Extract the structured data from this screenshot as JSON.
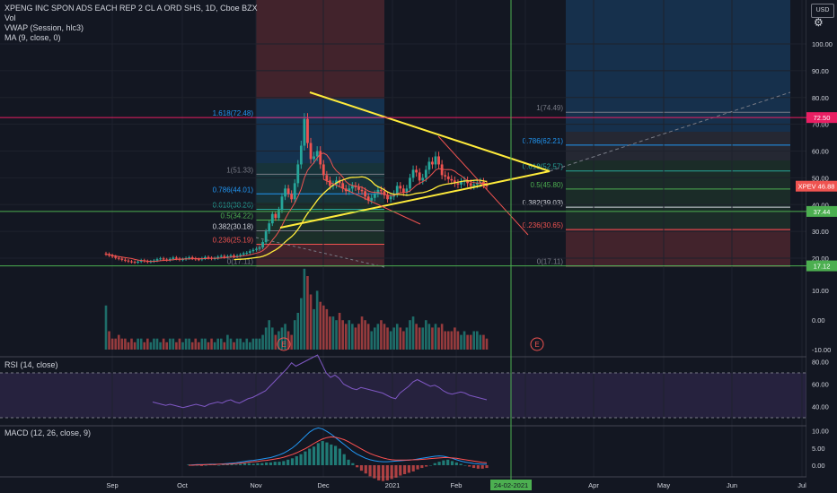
{
  "legend": {
    "symbol": "XPENG INC SPON ADS EACH REP 2 CL A ORD SHS, 1D, Cboe BZX",
    "vol": "Vol",
    "vwap": "VWAP (Session, hlc3)",
    "ma": "MA (9, close, 0)"
  },
  "toolbar": {
    "currency": "USD",
    "settings_icon": "gear-icon"
  },
  "panes": {
    "rsi_label": "RSI (14, close)",
    "macd_label": "MACD (12, 26, close, 9)"
  },
  "colors": {
    "background": "#131722",
    "up": "#26a69a",
    "down": "#ef5350",
    "triangle": "#ffeb3b",
    "green_line": "#4caf50",
    "magenta_line": "#e91e63",
    "rsi_line": "#7e57c2",
    "macd_line": "#2196f3",
    "signal_line": "#ff5252",
    "ma_line": "#ef5350",
    "vwap_line": "#ffeb3b"
  },
  "chart_data": [
    {
      "type": "candlestick",
      "pane": "price",
      "ylim": [
        10,
        105
      ],
      "y_ticks": [
        "100.00",
        "90.00",
        "80.00",
        "70.00",
        "60.00",
        "50.00",
        "40.00",
        "30.00",
        "20.00"
      ],
      "x_ticks": [
        "Sep",
        "Oct",
        "Nov",
        "Dec",
        "2021",
        "Feb",
        "Mar",
        "Apr",
        "May",
        "Jun",
        "Jul"
      ],
      "price_labels": [
        {
          "text": "72.50",
          "value": 72.5,
          "color": "#e91e63"
        },
        {
          "text": "XPEV  46.88",
          "value": 46.88,
          "color": "#ef5350"
        },
        {
          "text": "37.44",
          "value": 37.44,
          "color": "#4caf50"
        },
        {
          "text": "17.12",
          "value": 17.12,
          "color": "#4caf50"
        }
      ],
      "date_label": "24-02-2021",
      "fib_left": [
        {
          "text": "1.618(72.48)",
          "value": 72.48,
          "color": "#2196f3"
        },
        {
          "text": "1(51.33)",
          "value": 51.33,
          "color": "#787b86"
        },
        {
          "text": "0.786(44.01)",
          "value": 44.01,
          "color": "#2196f3"
        },
        {
          "text": "0.618(38.26)",
          "value": 38.26,
          "color": "#26a69a"
        },
        {
          "text": "0.5(34.22)",
          "value": 34.22,
          "color": "#4caf50"
        },
        {
          "text": "0.382(30.18)",
          "value": 30.18,
          "color": "#d1d4dc"
        },
        {
          "text": "0.236(25.19)",
          "value": 25.19,
          "color": "#ef5350"
        },
        {
          "text": "0(17.11)",
          "value": 17.11,
          "color": "#787b86"
        }
      ],
      "fib_right": [
        {
          "text": "1(74.49)",
          "value": 74.49,
          "color": "#787b86"
        },
        {
          "text": "0.786(62.21)",
          "value": 62.21,
          "color": "#2196f3"
        },
        {
          "text": "0.618(52.57)",
          "value": 52.57,
          "color": "#26a69a"
        },
        {
          "text": "0.5(45.80)",
          "value": 45.8,
          "color": "#4caf50"
        },
        {
          "text": "0.382(39.03)",
          "value": 39.03,
          "color": "#d1d4dc"
        },
        {
          "text": "0.236(30.65)",
          "value": 30.65,
          "color": "#ef5350"
        },
        {
          "text": "0(17.11)",
          "value": 17.11,
          "color": "#787b86"
        }
      ],
      "closes": [
        21.5,
        21.0,
        20.6,
        20.1,
        19.8,
        19.4,
        19.1,
        18.8,
        18.6,
        18.4,
        18.7,
        19.2,
        18.9,
        18.6,
        18.8,
        19.1,
        19.6,
        19.9,
        19.5,
        19.3,
        19.7,
        20.2,
        19.8,
        19.4,
        19.6,
        20.0,
        20.3,
        19.9,
        19.6,
        19.5,
        19.9,
        20.4,
        20.1,
        19.8,
        20.0,
        20.5,
        20.8,
        20.4,
        20.7,
        21.0,
        20.6,
        20.9,
        21.3,
        21.8,
        22.0,
        22.6,
        23.1,
        23.5,
        24.0,
        26.0,
        30.0,
        33.0,
        36.5,
        35.0,
        38.0,
        43.0,
        46.0,
        44.0,
        42.0,
        48.0,
        55.0,
        62.0,
        72.0,
        63.0,
        57.0,
        58.0,
        60.0,
        55.0,
        51.0,
        49.0,
        47.0,
        47.5,
        49.0,
        48.0,
        46.0,
        45.0,
        46.0,
        47.0,
        46.5,
        45.5,
        45.0,
        43.0,
        41.5,
        42.5,
        44.0,
        45.5,
        45.0,
        43.5,
        42.0,
        43.0,
        44.0,
        47.0,
        46.0,
        44.5,
        46.0,
        50.0,
        53.0,
        52.0,
        49.0,
        50.0,
        53.0,
        56.0,
        55.0,
        58.0,
        55.0,
        51.0,
        50.5,
        49.5,
        49.0,
        48.0,
        47.5,
        48.5,
        49.0,
        48.0,
        47.0,
        47.5,
        48.0,
        48.5,
        47.5,
        46.9
      ]
    },
    {
      "type": "bar",
      "pane": "volume",
      "y_ticks": [
        "10.00",
        "0.00",
        "-10.00"
      ],
      "values": [
        12,
        5,
        3,
        3,
        4,
        3,
        3,
        2,
        3,
        2,
        3,
        3,
        2,
        3,
        2,
        3,
        3,
        2,
        3,
        2,
        3,
        3,
        2,
        3,
        2,
        3,
        3,
        2,
        3,
        2,
        3,
        3,
        2,
        3,
        2,
        3,
        3,
        2,
        4,
        3,
        2,
        3,
        3,
        2,
        3,
        2,
        3,
        3,
        3,
        4,
        6,
        8,
        6,
        4,
        5,
        6,
        7,
        5,
        4,
        8,
        10,
        14,
        22,
        20,
        15,
        11,
        16,
        13,
        12,
        11,
        9,
        9,
        8,
        10,
        8,
        7,
        8,
        7,
        6,
        7,
        9,
        8,
        7,
        5,
        6,
        7,
        8,
        7,
        6,
        5,
        6,
        7,
        6,
        5,
        6,
        8,
        9,
        7,
        6,
        6,
        8,
        7,
        6,
        7,
        6,
        7,
        5,
        5,
        5,
        6,
        5,
        4,
        5,
        4,
        4,
        5,
        5,
        4,
        4,
        3
      ]
    },
    {
      "type": "line",
      "pane": "rsi",
      "y_ticks": [
        "80.00",
        "60.00",
        "40.00"
      ],
      "ylim": [
        20,
        90
      ],
      "bands": [
        70,
        30
      ],
      "values": [
        44,
        43,
        42,
        41,
        42,
        41,
        40,
        39,
        40,
        41,
        42,
        41,
        40,
        42,
        43,
        44,
        43,
        45,
        46,
        44,
        43,
        45,
        47,
        48,
        50,
        52,
        54,
        58,
        62,
        66,
        70,
        74,
        79,
        76,
        78,
        80,
        82,
        84,
        86,
        78,
        70,
        66,
        68,
        65,
        60,
        58,
        56,
        55,
        57,
        56,
        55,
        54,
        53,
        52,
        50,
        48,
        47,
        52,
        55,
        58,
        62,
        64,
        62,
        60,
        58,
        59,
        57,
        54,
        52,
        51,
        52,
        53,
        52,
        50,
        49,
        48,
        47,
        46
      ]
    },
    {
      "type": "bar",
      "pane": "macd",
      "y_ticks": [
        "10.00",
        "5.00",
        "0.00"
      ],
      "ylim": [
        -3.5,
        12
      ],
      "histogram": [
        0.1,
        0.1,
        0.0,
        -0.1,
        0.0,
        0.1,
        0.1,
        0.0,
        0.1,
        0.2,
        0.2,
        0.1,
        0.2,
        0.3,
        0.3,
        0.2,
        0.3,
        0.3,
        0.4,
        0.4,
        0.5,
        0.5,
        0.6,
        0.8,
        1.0,
        1.3,
        1.6,
        2.0,
        2.4,
        2.7,
        3.2,
        3.5,
        3.3,
        3.0,
        2.8,
        2.4,
        1.6,
        0.8,
        0.3,
        -0.3,
        -0.8,
        -1.2,
        -1.6,
        -1.9,
        -2.2,
        -2.3,
        -2.2,
        -2.0,
        -1.8,
        -1.5,
        -1.3,
        -1.1,
        -0.9,
        -0.6,
        -0.4,
        -0.2,
        0.0,
        0.3,
        0.5,
        0.7,
        0.8,
        0.6,
        0.4,
        0.2,
        0.0,
        -0.2,
        -0.4,
        -0.5,
        -0.5,
        -0.4
      ],
      "macd_line": [
        0.0,
        0.1,
        0.2,
        0.2,
        0.2,
        0.3,
        0.3,
        0.3,
        0.4,
        0.5,
        0.6,
        0.7,
        0.9,
        1.1,
        1.3,
        1.4,
        1.6,
        1.8,
        2.0,
        2.2,
        2.6,
        3.0,
        3.5,
        4.2,
        5.0,
        6.0,
        7.2,
        8.4,
        9.6,
        10.4,
        10.8,
        10.5,
        9.8,
        9.0,
        8.0,
        7.0,
        6.0,
        5.0,
        4.0,
        3.2,
        2.6,
        2.0,
        1.6,
        1.3,
        1.1,
        1.0,
        1.0,
        1.1,
        1.2,
        1.3,
        1.4,
        1.5,
        1.6,
        1.8,
        2.0,
        2.2,
        2.4,
        2.6,
        2.7,
        2.6,
        2.3,
        2.0,
        1.6,
        1.2,
        0.9,
        0.7,
        0.5,
        0.4,
        0.3,
        0.3
      ],
      "signal_line": [
        0.0,
        0.0,
        0.1,
        0.1,
        0.2,
        0.2,
        0.2,
        0.3,
        0.3,
        0.3,
        0.4,
        0.5,
        0.6,
        0.7,
        0.9,
        1.0,
        1.1,
        1.3,
        1.4,
        1.6,
        1.8,
        2.0,
        2.3,
        2.7,
        3.1,
        3.6,
        4.2,
        4.8,
        5.5,
        6.3,
        7.0,
        7.6,
        8.0,
        8.2,
        8.1,
        7.8,
        7.4,
        6.8,
        6.1,
        5.4,
        4.7,
        4.0,
        3.4,
        2.9,
        2.5,
        2.1,
        1.8,
        1.6,
        1.5,
        1.5,
        1.5,
        1.5,
        1.6,
        1.6,
        1.7,
        1.8,
        1.9,
        2.0,
        2.1,
        2.2,
        2.2,
        2.1,
        2.0,
        1.8,
        1.6,
        1.4,
        1.2,
        1.0,
        0.8,
        0.7
      ]
    }
  ]
}
